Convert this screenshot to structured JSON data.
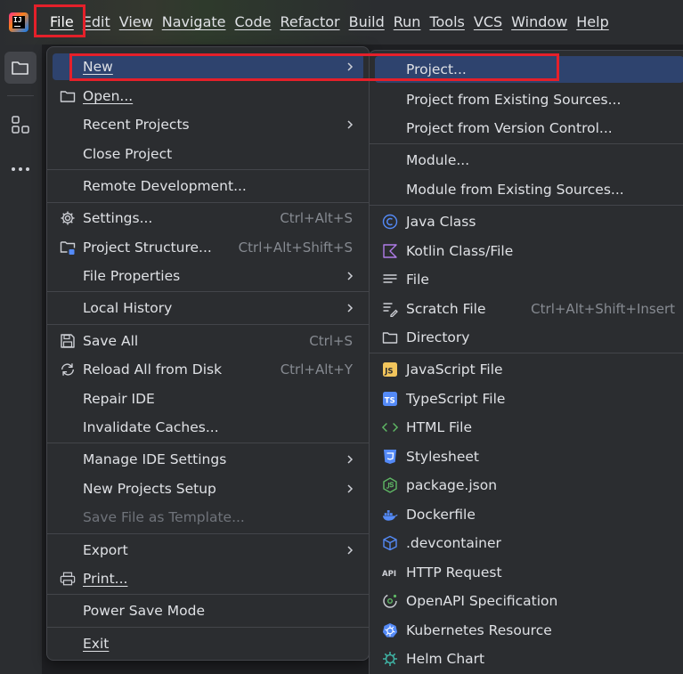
{
  "menubar": {
    "items": [
      "File",
      "Edit",
      "View",
      "Navigate",
      "Code",
      "Refactor",
      "Build",
      "Run",
      "Tools",
      "VCS",
      "Window",
      "Help"
    ],
    "active": "File"
  },
  "toolstrip": {
    "icons": [
      "folder-icon",
      "structure-icon",
      "more-icon"
    ]
  },
  "file_menu": {
    "items": [
      {
        "label": "New",
        "submenu": true,
        "selected": true
      },
      {
        "label": "Open...",
        "icon": "folder-icon"
      },
      {
        "label": "Recent Projects",
        "submenu": true
      },
      {
        "label": "Close Project"
      },
      {
        "label": "Remote Development..."
      },
      {
        "label": "Settings...",
        "icon": "gear-icon",
        "shortcut": "Ctrl+Alt+S"
      },
      {
        "label": "Project Structure...",
        "icon": "project-structure-icon",
        "shortcut": "Ctrl+Alt+Shift+S"
      },
      {
        "label": "File Properties",
        "submenu": true
      },
      {
        "label": "Local History",
        "submenu": true
      },
      {
        "label": "Save All",
        "icon": "save-icon",
        "shortcut": "Ctrl+S"
      },
      {
        "label": "Reload All from Disk",
        "icon": "reload-icon",
        "shortcut": "Ctrl+Alt+Y"
      },
      {
        "label": "Repair IDE"
      },
      {
        "label": "Invalidate Caches..."
      },
      {
        "label": "Manage IDE Settings",
        "submenu": true
      },
      {
        "label": "New Projects Setup",
        "submenu": true
      },
      {
        "label": "Save File as Template...",
        "disabled": true
      },
      {
        "label": "Export",
        "submenu": true
      },
      {
        "label": "Print...",
        "icon": "print-icon"
      },
      {
        "label": "Power Save Mode"
      },
      {
        "label": "Exit"
      }
    ]
  },
  "new_submenu": {
    "items": [
      {
        "label": "Project..."
      },
      {
        "label": "Project from Existing Sources..."
      },
      {
        "label": "Project from Version Control..."
      },
      {
        "label": "Module..."
      },
      {
        "label": "Module from Existing Sources..."
      },
      {
        "label": "Java Class",
        "icon": "java-class-icon"
      },
      {
        "label": "Kotlin Class/File",
        "icon": "kotlin-icon"
      },
      {
        "label": "File",
        "icon": "text-file-icon"
      },
      {
        "label": "Scratch File",
        "icon": "scratch-file-icon",
        "shortcut": "Ctrl+Alt+Shift+Insert"
      },
      {
        "label": "Directory",
        "icon": "folder-icon"
      },
      {
        "label": "JavaScript File",
        "icon": "javascript-icon"
      },
      {
        "label": "TypeScript File",
        "icon": "typescript-icon"
      },
      {
        "label": "HTML File",
        "icon": "html-icon"
      },
      {
        "label": "Stylesheet",
        "icon": "css-icon"
      },
      {
        "label": "package.json",
        "icon": "nodejs-icon"
      },
      {
        "label": "Dockerfile",
        "icon": "docker-icon"
      },
      {
        "label": ".devcontainer",
        "icon": "devcontainer-icon"
      },
      {
        "label": "HTTP Request",
        "icon": "api-icon"
      },
      {
        "label": "OpenAPI Specification",
        "icon": "openapi-icon"
      },
      {
        "label": "Kubernetes Resource",
        "icon": "kubernetes-icon"
      },
      {
        "label": "Helm Chart",
        "icon": "helm-icon"
      }
    ]
  },
  "icon_texts": {
    "js": "JS",
    "ts": "TS",
    "api": "API",
    "ij": "IJ"
  },
  "colors": {
    "highlight_border": "#e5202a",
    "selection": "#2e436e",
    "menu_bg": "#2b2d30"
  }
}
